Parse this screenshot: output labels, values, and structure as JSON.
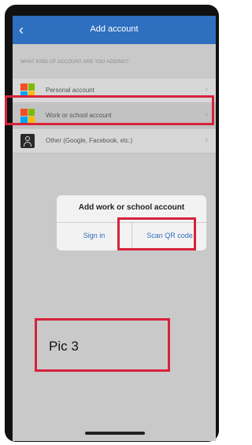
{
  "header": {
    "title": "Add account",
    "back_icon": "chevron-left-icon"
  },
  "section_label": "WHAT KIND OF ACCOUNT ARE YOU ADDING?",
  "accounts": [
    {
      "label": "Personal account",
      "icon": "microsoft-logo-icon"
    },
    {
      "label": "Work or school account",
      "icon": "microsoft-logo-icon"
    },
    {
      "label": "Other (Google, Facebook, etc.)",
      "icon": "person-icon"
    }
  ],
  "dialog": {
    "title": "Add work or school account",
    "sign_in": "Sign in",
    "scan_qr": "Scan QR code"
  },
  "caption": "Pic 3",
  "colors": {
    "header_blue": "#2f6fbf",
    "highlight_red": "#d6223a",
    "ms_red": "#f25022",
    "ms_green": "#7fba00",
    "ms_blue": "#00a4ef",
    "ms_yellow": "#ffb900"
  }
}
